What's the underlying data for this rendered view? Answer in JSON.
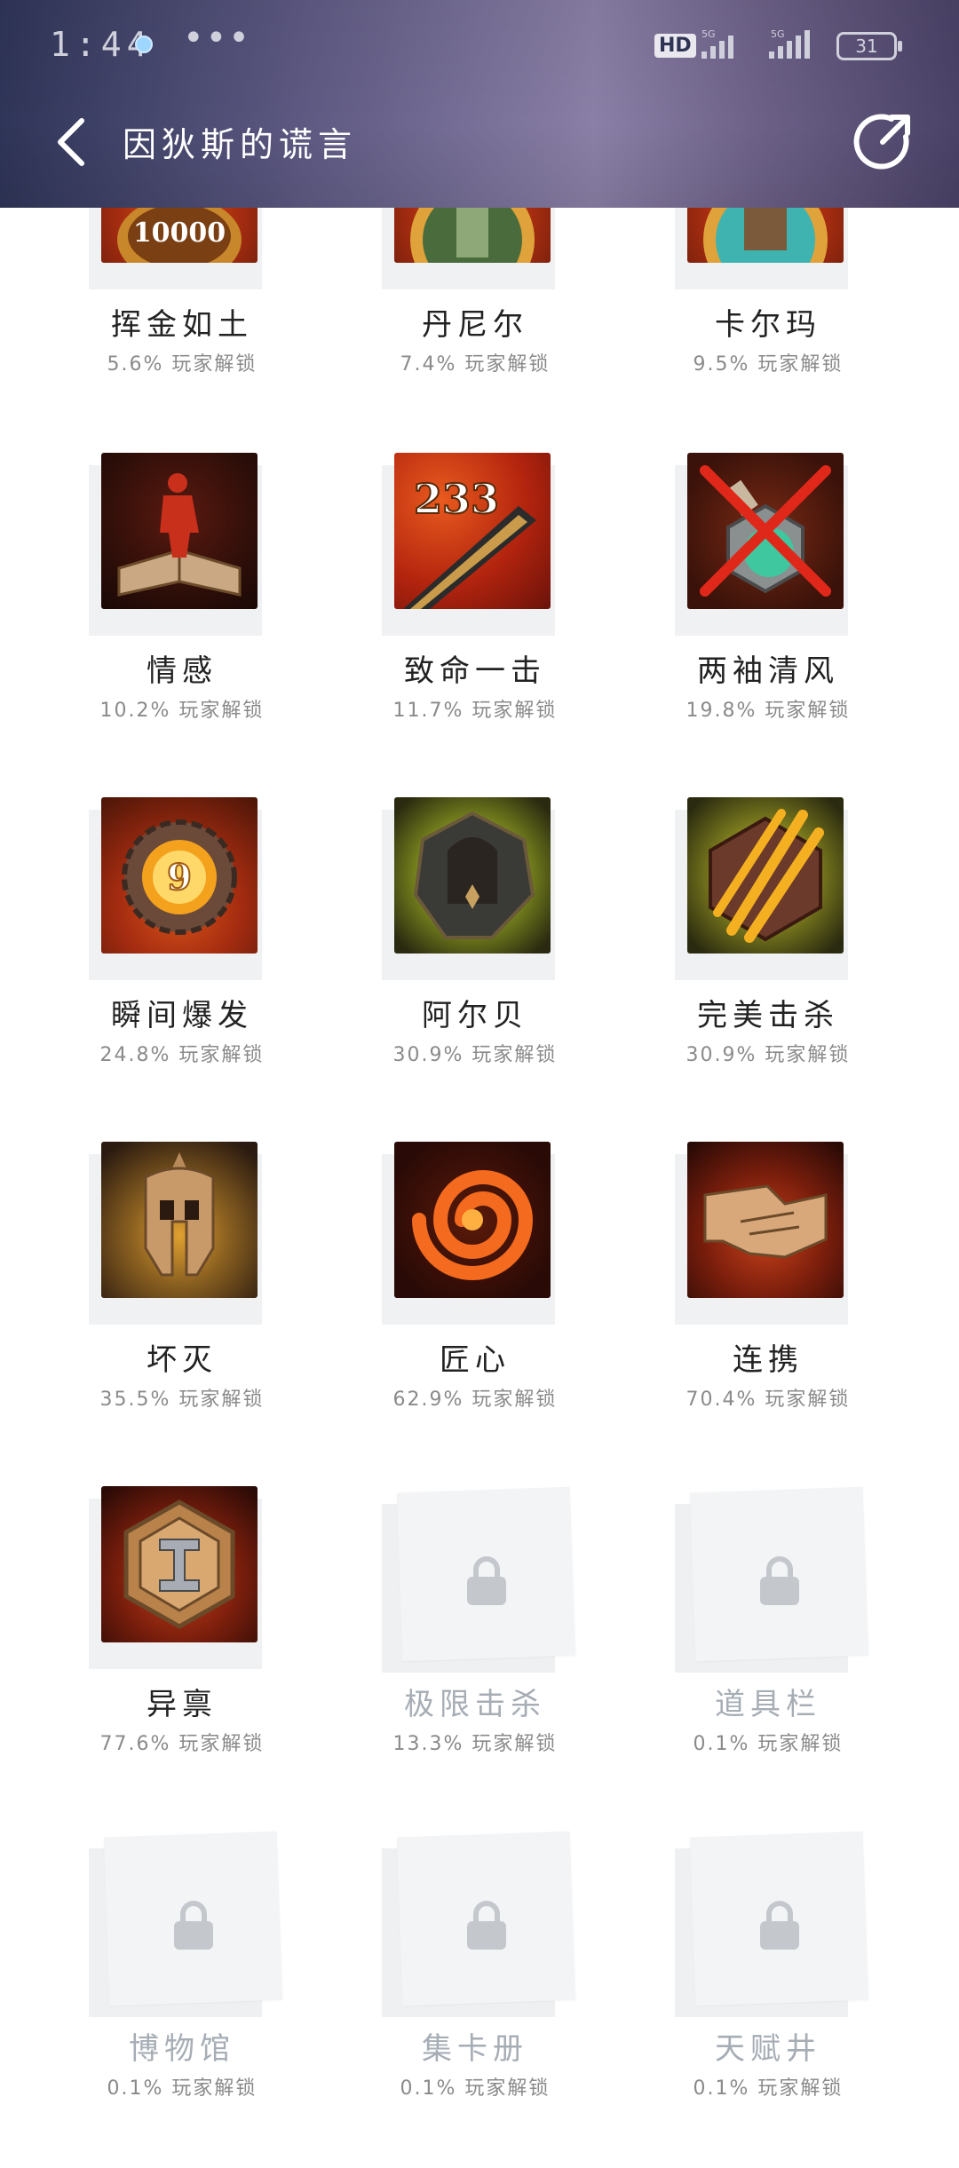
{
  "status_bar": {
    "time": "1:44",
    "more": "•••",
    "network_hd": "HD",
    "network_1": "5G",
    "network_2": "5G",
    "battery": "31"
  },
  "nav": {
    "title": "因狄斯的谎言"
  },
  "achievements": [
    {
      "name": "挥金如土",
      "percent": "5.6% 玩家解锁",
      "locked": false,
      "icon": "gold-coin-10000-icon",
      "badge_text": "10000"
    },
    {
      "name": "丹尼尔",
      "percent": "7.4% 玩家解锁",
      "locked": false,
      "icon": "character-daniel-icon"
    },
    {
      "name": "卡尔玛",
      "percent": "9.5% 玩家解锁",
      "locked": false,
      "icon": "character-karma-icon"
    },
    {
      "name": "情感",
      "percent": "10.2% 玩家解锁",
      "locked": false,
      "icon": "figure-on-book-icon"
    },
    {
      "name": "致命一击",
      "percent": "11.7% 玩家解锁",
      "locked": false,
      "icon": "sword-damage-233-icon",
      "badge_text": "233"
    },
    {
      "name": "两袖清风",
      "percent": "19.8% 玩家解锁",
      "locked": false,
      "icon": "crossed-potion-icon"
    },
    {
      "name": "瞬间爆发",
      "percent": "24.8% 玩家解锁",
      "locked": false,
      "icon": "gear-nine-icon",
      "badge_text": "9"
    },
    {
      "name": "阿尔贝",
      "percent": "30.9% 玩家解锁",
      "locked": false,
      "icon": "hooded-figure-icon"
    },
    {
      "name": "完美击杀",
      "percent": "30.9% 玩家解锁",
      "locked": false,
      "icon": "claw-slash-icon"
    },
    {
      "name": "坏灭",
      "percent": "35.5% 玩家解锁",
      "locked": false,
      "icon": "spartan-helmet-icon"
    },
    {
      "name": "匠心",
      "percent": "62.9% 玩家解锁",
      "locked": false,
      "icon": "fire-swirl-icon"
    },
    {
      "name": "连携",
      "percent": "70.4% 玩家解锁",
      "locked": false,
      "icon": "handshake-icon"
    },
    {
      "name": "异禀",
      "percent": "77.6% 玩家解锁",
      "locked": false,
      "icon": "hexagon-rune-icon"
    },
    {
      "name": "极限击杀",
      "percent": "13.3% 玩家解锁",
      "locked": true,
      "icon": "lock-icon"
    },
    {
      "name": "道具栏",
      "percent": "0.1% 玩家解锁",
      "locked": true,
      "icon": "lock-icon"
    },
    {
      "name": "博物馆",
      "percent": "0.1% 玩家解锁",
      "locked": true,
      "icon": "lock-icon"
    },
    {
      "name": "集卡册",
      "percent": "0.1% 玩家解锁",
      "locked": true,
      "icon": "lock-icon"
    },
    {
      "name": "天赋井",
      "percent": "0.1% 玩家解锁",
      "locked": true,
      "icon": "lock-icon"
    }
  ],
  "colors": {
    "header_start": "#2f3558",
    "header_mid": "#8a7fa6",
    "locked_text": "#a6adb5",
    "pct_text": "#8a8a8a"
  }
}
